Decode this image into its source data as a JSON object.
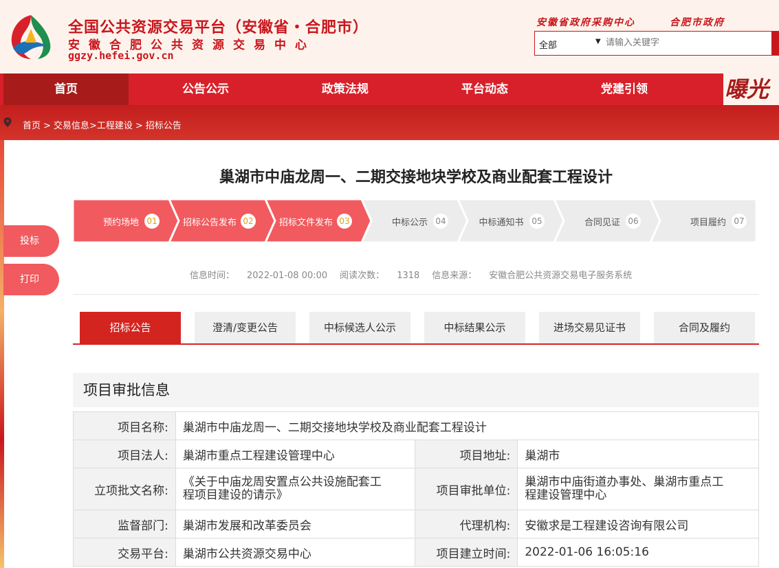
{
  "header": {
    "title": "全国公共资源交易平台（安徽省・合肥市）",
    "subtitle": "安徽合肥公共资源交易中心",
    "url": "ggzy.hefei.gov.cn",
    "link_1": "安徽省政府采购中心",
    "link_2": "合肥市政府",
    "search_select": "全部",
    "search_placeholder": "请输入关键字"
  },
  "colors": {
    "brand": "#c9161d",
    "nav": "#d8202a",
    "nav_active": "#a71b1b",
    "step_active": "#f15a5e",
    "tab_active": "#d42420"
  },
  "nav": {
    "items": [
      "首页",
      "公告公示",
      "政策法规",
      "平台动态",
      "党建引领"
    ],
    "promo": "曝光"
  },
  "breadcrumb": [
    "首页",
    "交易信息",
    "工程建设",
    "招标公告"
  ],
  "side": {
    "bid": "投标",
    "print": "打印"
  },
  "page_title": "巢湖市中庙龙周一、二期交接地块学校及商业配套工程设计",
  "steps": [
    {
      "label": "预约场地",
      "num": "01",
      "active": true
    },
    {
      "label": "招标公告发布",
      "num": "02",
      "active": true
    },
    {
      "label": "招标文件发布",
      "num": "03",
      "active": true
    },
    {
      "label": "中标公示",
      "num": "04",
      "active": false
    },
    {
      "label": "中标通知书",
      "num": "05",
      "active": false
    },
    {
      "label": "合同见证",
      "num": "06",
      "active": false
    },
    {
      "label": "项目履约",
      "num": "07",
      "active": false
    }
  ],
  "info": {
    "time_label": "信息时间：",
    "time": "2022-01-08 00:00",
    "reads_label": "阅读次数：",
    "reads": "1318",
    "source_label": "信息来源：",
    "source": "安徽合肥公共资源交易电子服务系统"
  },
  "tabs": [
    "招标公告",
    "澄清/变更公告",
    "中标候选人公示",
    "中标结果公示",
    "进场交易见证书",
    "合同及履约"
  ],
  "section": {
    "title": "项目审批信息",
    "name_label": "项目名称:",
    "name": "巢湖市中庙龙周一、二期交接地块学校及商业配套工程设计",
    "legal_label": "项目法人:",
    "legal": "巢湖市重点工程建设管理中心",
    "addr_label": "项目地址:",
    "addr": "巢湖市",
    "doc_label": "立项批文名称:",
    "doc_1": "《关于中庙龙周安置点公共设施配套工",
    "doc_2": "程项目建设的请示》",
    "unit_label": "项目审批单位:",
    "unit_1": "巢湖市中庙街道办事处、巢湖市重点工",
    "unit_2": "程建设管理中心",
    "sup_label": "监督部门:",
    "sup": "巢湖市发展和改革委员会",
    "agent_label": "代理机构:",
    "agent": "安徽求是工程建设咨询有限公司",
    "platform_label": "交易平台:",
    "platform": "巢湖市公共资源交易中心",
    "created_label": "项目建立时间:",
    "created": "2022-01-06 16:05:16"
  }
}
